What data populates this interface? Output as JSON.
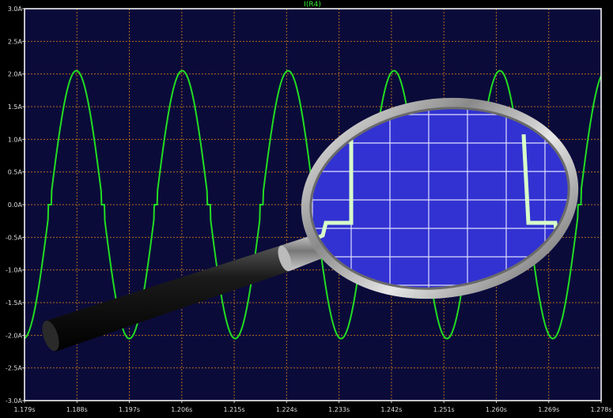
{
  "chart_data": {
    "type": "line",
    "title": "I(R4)",
    "xlabel": "",
    "ylabel": "",
    "xlim": [
      1.179,
      1.278
    ],
    "ylim": [
      -3.0,
      3.0
    ],
    "x_ticks": [
      "1.179s",
      "1.188s",
      "1.197s",
      "1.206s",
      "1.215s",
      "1.224s",
      "1.233s",
      "1.242s",
      "1.251s",
      "1.260s",
      "1.269s",
      "1.278s"
    ],
    "y_ticks": [
      "3.0A",
      "2.5A",
      "2.0A",
      "1.5A",
      "1.0A",
      "0.5A",
      "0.0A",
      "-0.5A",
      "-1.0A",
      "-1.5A",
      "-2.0A",
      "-2.5A",
      "-3.0A"
    ],
    "grid": true,
    "series": [
      {
        "name": "I(R4)",
        "color": "#22dd22",
        "model": {
          "kind": "clipped-sine",
          "amplitude": 2.05,
          "period": 0.01818,
          "phase_peak_x": 1.1879,
          "deadband_threshold": 0.2
        }
      }
    ]
  },
  "colors": {
    "page_background": "#000000",
    "plot_background": "#0b0b3a",
    "grid": "#b36a1a",
    "axis_labels": "#dddddd",
    "title": "#33ee33"
  },
  "overlay": {
    "icon": "magnifying-glass-icon",
    "lens_background": "#3232d2",
    "lens_grid": "#e0e0ff",
    "lens_trace": "#d8ffc8"
  }
}
